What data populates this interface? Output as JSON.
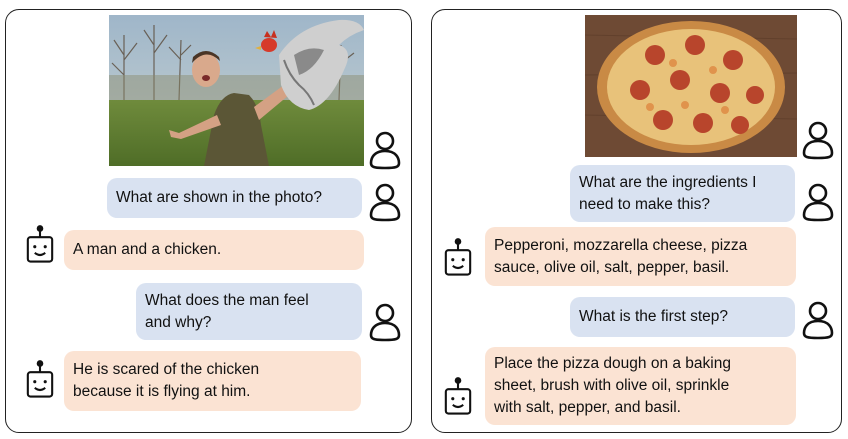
{
  "left_chat": {
    "messages": [
      {
        "role": "user",
        "text": "What are shown in the photo?"
      },
      {
        "role": "bot",
        "text": "A man and a chicken."
      },
      {
        "role": "user",
        "text": "What does the man feel\nand why?"
      },
      {
        "role": "bot",
        "text": "He is scared of the chicken\nbecause it is flying at him."
      }
    ]
  },
  "right_chat": {
    "messages": [
      {
        "role": "user",
        "text": "What are the ingredients I\nneed to make this?"
      },
      {
        "role": "bot",
        "text": "Pepperoni, mozzarella cheese, pizza\nsauce, olive oil, salt, pepper, basil."
      },
      {
        "role": "user",
        "text": "What is the first step?"
      },
      {
        "role": "bot",
        "text": "Place the pizza dough on a baking\nsheet, brush with olive oil, sprinkle\nwith salt, pepper, and basil."
      }
    ]
  },
  "colors": {
    "user_bubble": "#d9e2f1",
    "bot_bubble": "#fbe3d3",
    "border": "#222222"
  },
  "icons": {
    "user": "user-icon",
    "bot": "robot-icon"
  }
}
